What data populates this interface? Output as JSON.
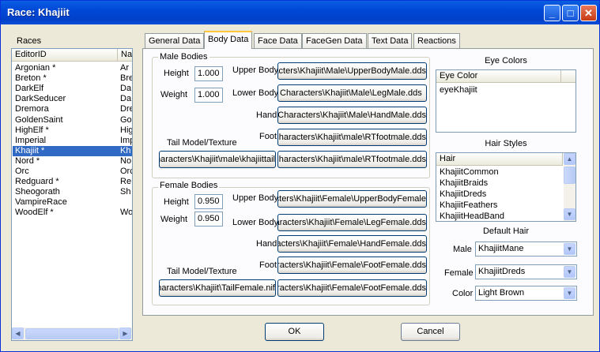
{
  "window": {
    "title": "Race: Khajiit",
    "minimize": "_",
    "maximize": "□",
    "close": "✕"
  },
  "races": {
    "group_label": "Races",
    "columns": [
      "EditorID",
      "Na"
    ],
    "rows": [
      {
        "id": "Argonian *",
        "name": "Ar"
      },
      {
        "id": "Breton *",
        "name": "Bre"
      },
      {
        "id": "DarkElf",
        "name": "Da"
      },
      {
        "id": "DarkSeducer",
        "name": "Da"
      },
      {
        "id": "Dremora",
        "name": "Dre"
      },
      {
        "id": "GoldenSaint",
        "name": "Go"
      },
      {
        "id": "HighElf *",
        "name": "Hig"
      },
      {
        "id": "Imperial",
        "name": "Imp"
      },
      {
        "id": "Khajiit *",
        "name": "Kh"
      },
      {
        "id": "Nord *",
        "name": "No"
      },
      {
        "id": "Orc",
        "name": "Orc"
      },
      {
        "id": "Redguard *",
        "name": "Re"
      },
      {
        "id": "Sheogorath",
        "name": "Sh"
      },
      {
        "id": "VampireRace",
        "name": ""
      },
      {
        "id": "WoodElf *",
        "name": "Wo"
      }
    ],
    "selected_index": 8
  },
  "tabs": [
    "General Data",
    "Body Data",
    "Face Data",
    "FaceGen Data",
    "Text Data",
    "Reactions"
  ],
  "active_tab": "Body Data",
  "male": {
    "group_label": "Male Bodies",
    "height_label": "Height",
    "height": "1.000",
    "weight_label": "Weight",
    "weight": "1.000",
    "upper_label": "Upper Body",
    "upper": "Characters\\Khajiit\\Male\\UpperBodyMale.dds",
    "lower_label": "Lower Body",
    "lower": "Characters\\Khajiit\\Male\\LegMale.dds",
    "hand_label": "Hand",
    "hand": "Characters\\Khajiit\\Male\\HandMale.dds",
    "foot_label": "Foot",
    "foot": "Characters\\Khajiit\\male\\RTfootmale.dds",
    "tail_label": "Tail Model/Texture",
    "tail_model": "Characters\\Khajiit\\male\\khajiittail",
    "tail_texture": "Characters\\Khajiit\\male\\RTfootmale.dds"
  },
  "female": {
    "group_label": "Female Bodies",
    "height_label": "Height",
    "height": "0.950",
    "weight_label": "Weight",
    "weight": "0.950",
    "upper_label": "Upper Body",
    "upper": "Characters\\Khajiit\\Female\\UpperBodyFemale",
    "lower_label": "Lower Body",
    "lower": "Characters\\Khajiit\\Female\\LegFemale.dds",
    "hand_label": "Hand",
    "hand": "Characters\\Khajiit\\Female\\HandFemale.dds",
    "foot_label": "Foot",
    "foot": "Characters\\Khajiit\\Female\\FootFemale.dds",
    "tail_label": "Tail Model/Texture",
    "tail_model": "Characters\\Khajiit\\TailFemale.nif",
    "tail_texture": "Characters\\Khajiit\\Female\\FootFemale.dds"
  },
  "eye_colors": {
    "title": "Eye Colors",
    "column": "Eye Color",
    "items": [
      "eyeKhajiit"
    ]
  },
  "hair_styles": {
    "title": "Hair Styles",
    "column": "Hair",
    "items": [
      "KhajiitCommon",
      "KhajiitBraids",
      "KhajiitDreds",
      "KhajiitFeathers",
      "KhajiitHeadBand"
    ]
  },
  "default_hair": {
    "title": "Default Hair",
    "male_label": "Male",
    "male": "KhajiitMane",
    "female_label": "Female",
    "female": "KhajiitDreds",
    "color_label": "Color",
    "color": "Light Brown"
  },
  "buttons": {
    "ok": "OK",
    "cancel": "Cancel"
  }
}
